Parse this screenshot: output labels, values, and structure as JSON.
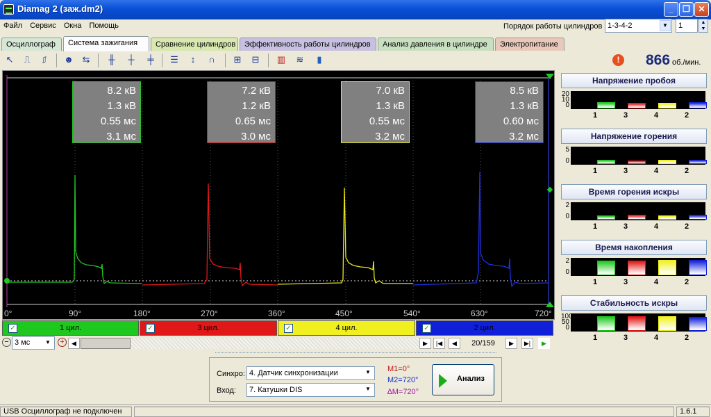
{
  "window": {
    "title": "Diamag 2 (заж.dm2)"
  },
  "menu": [
    "Файл",
    "Сервис",
    "Окна",
    "Помощь"
  ],
  "cylinder_order": {
    "label": "Порядок работы цилиндров",
    "value": "1-3-4-2",
    "count": "1"
  },
  "tabs": [
    {
      "label": "Осциллограф",
      "color": "#d6e7d6"
    },
    {
      "label": "Система зажигания",
      "color": "#fcfcfe"
    },
    {
      "label": "Сравнение цилиндров",
      "color": "#d8e8b0"
    },
    {
      "label": "Эффективность работы цилиндров",
      "color": "#c8c0e0"
    },
    {
      "label": "Анализ давления в цилиндре",
      "color": "#c8e0c0"
    },
    {
      "label": "Электропитание",
      "color": "#e8c8b8"
    }
  ],
  "rpm": {
    "value": "866",
    "unit": "об./мин."
  },
  "infoboxes": [
    {
      "lines": [
        "8.2 кВ",
        "1.3 кВ",
        "0.55 мс",
        "3.1 мс"
      ],
      "color": "#22c822"
    },
    {
      "lines": [
        "7.2 кВ",
        "1.2 кВ",
        "0.65 мс",
        "3.0 мс"
      ],
      "color": "#e01818"
    },
    {
      "lines": [
        "7.0 кВ",
        "1.3 кВ",
        "0.55 мс",
        "3.2 мс"
      ],
      "color": "#e8e818"
    },
    {
      "lines": [
        "8.5 кВ",
        "1.3 кВ",
        "0.60 мс",
        "3.2 мс"
      ],
      "color": "#2030e0"
    }
  ],
  "degree_ticks": [
    "0°",
    "90°",
    "180°",
    "270°",
    "360°",
    "450°",
    "540°",
    "630°",
    "720°"
  ],
  "cylinders": [
    {
      "label": "1 цил.",
      "color": "#1ec81e",
      "checked": "✓"
    },
    {
      "label": "3 цил.",
      "color": "#e01818",
      "checked": "✓"
    },
    {
      "label": "4 цил.",
      "color": "#f0f020",
      "checked": "✓"
    },
    {
      "label": "2 цил.",
      "color": "#1020d8",
      "checked": "✓"
    }
  ],
  "timebase": {
    "value": "3 мс"
  },
  "page": {
    "current": "20/159"
  },
  "sync": {
    "label": "Синхро:",
    "value": "4.  Датчик синхронизации",
    "input_label": "Вход:",
    "input_value": "7.  Катушки DIS"
  },
  "markers": {
    "m1": "M1=0°",
    "m2": "M2=720°",
    "dm": "∆M=720°"
  },
  "analyze_button": "Анализ",
  "status": {
    "left": "USB Осциллограф не подключен",
    "version": "1.6.1"
  },
  "panels": [
    {
      "title": "Напряжение пробоя",
      "ticks": [
        "20",
        "10",
        "0"
      ],
      "max": 20,
      "values": [
        8.2,
        7.2,
        7.0,
        8.5
      ],
      "labels": [
        "1",
        "3",
        "4",
        "2"
      ]
    },
    {
      "title": "Напряжение горения",
      "ticks": [
        "5",
        "0"
      ],
      "max": 5,
      "values": [
        1.3,
        1.2,
        1.3,
        1.3
      ],
      "labels": [
        "1",
        "3",
        "4",
        "2"
      ]
    },
    {
      "title": "Время горения искры",
      "ticks": [
        "2",
        "0"
      ],
      "max": 2,
      "values": [
        0.55,
        0.65,
        0.55,
        0.6
      ],
      "labels": [
        "1",
        "3",
        "4",
        "2"
      ]
    },
    {
      "title": "Время накопления",
      "ticks": [
        "2",
        "0"
      ],
      "max": 3.2,
      "values": [
        3.1,
        3.0,
        3.2,
        3.2
      ],
      "labels": [
        "1",
        "3",
        "4",
        "2"
      ]
    },
    {
      "title": "Стабильность искры",
      "ticks": [
        "100",
        "50",
        "0"
      ],
      "max": 100,
      "values": [
        95,
        95,
        95,
        93
      ],
      "labels": [
        "1",
        "3",
        "4",
        "2"
      ]
    }
  ],
  "colors": {
    "cyl1": "#1ec81e",
    "cyl3": "#e01818",
    "cyl4": "#f0f020",
    "cyl2": "#1020d8",
    "title_bar": "#0a4fd6"
  }
}
